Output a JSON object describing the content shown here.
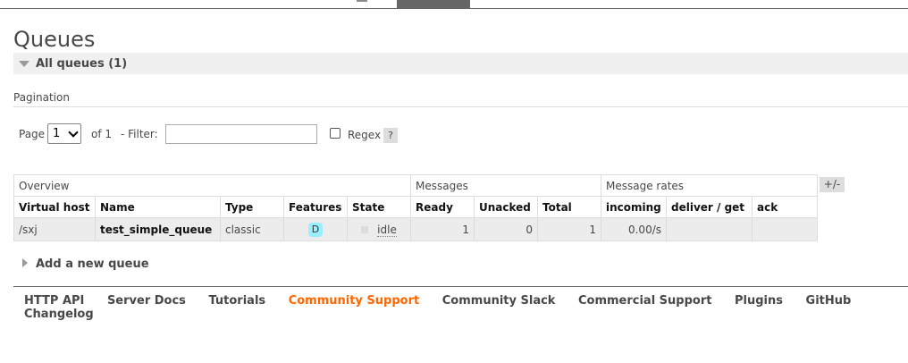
{
  "page": {
    "title": "Queues"
  },
  "section": {
    "label": "All queues (1)"
  },
  "pagination": {
    "label": "Pagination",
    "page_label": "Page",
    "page_value": "1",
    "of_label": "of 1",
    "filter_label": "- Filter:",
    "filter_value": "",
    "regex_label": "Regex",
    "help_label": "?"
  },
  "table": {
    "groups": [
      "Overview",
      "Messages",
      "Message rates"
    ],
    "columns": [
      "Virtual host",
      "Name",
      "Type",
      "Features",
      "State",
      "Ready",
      "Unacked",
      "Total",
      "incoming",
      "deliver / get",
      "ack"
    ],
    "rows": [
      {
        "vhost": "/sxj",
        "name": "test_simple_queue",
        "type": "classic",
        "feature": "D",
        "state": "idle",
        "ready": "1",
        "unacked": "0",
        "total": "1",
        "incoming": "0.00/s",
        "deliver_get": "",
        "ack": ""
      }
    ],
    "toggle_label": "+/-"
  },
  "add_queue": {
    "label": "Add a new queue"
  },
  "footer": {
    "links": [
      "HTTP API",
      "Server Docs",
      "Tutorials",
      "Community Support",
      "Community Slack",
      "Commercial Support",
      "Plugins",
      "GitHub",
      "Changelog"
    ],
    "active_color": "#ff6600"
  }
}
